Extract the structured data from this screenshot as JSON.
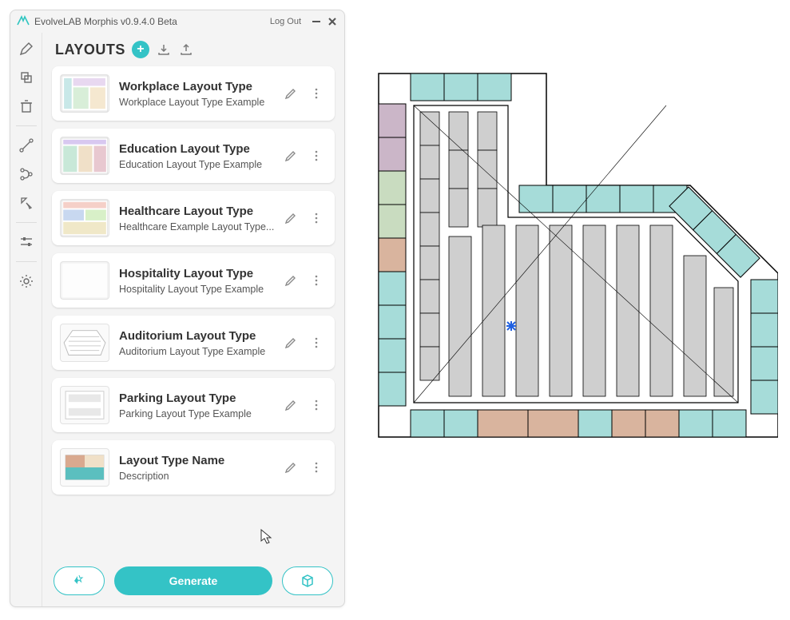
{
  "window": {
    "title": "EvolveLAB Morphis v0.9.4.0 Beta",
    "logout": "Log Out"
  },
  "header": {
    "title": "LAYOUTS"
  },
  "layouts": [
    {
      "title": "Workplace Layout Type",
      "desc": "Workplace Layout Type Example"
    },
    {
      "title": "Education Layout Type",
      "desc": "Education Layout Type Example"
    },
    {
      "title": "Healthcare Layout Type",
      "desc": "Healthcare Example Layout Type..."
    },
    {
      "title": "Hospitality Layout Type",
      "desc": "Hospitality Layout Type Example"
    },
    {
      "title": "Auditorium Layout Type",
      "desc": "Auditorium Layout Type Example"
    },
    {
      "title": "Parking Layout Type",
      "desc": "Parking Layout Type Example"
    },
    {
      "title": "Layout Type Name",
      "desc": "Description"
    }
  ],
  "footer": {
    "generate": "Generate"
  }
}
